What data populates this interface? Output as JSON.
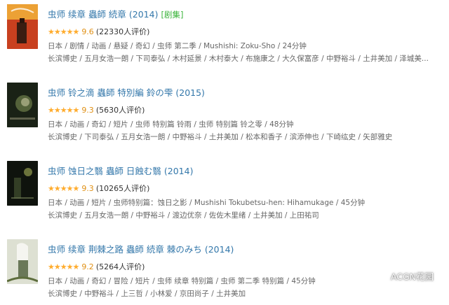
{
  "items": [
    {
      "title": "虫师 续章 蟲師 続章 (2014)",
      "play_label": "[剧集]",
      "stars": "★★★★★",
      "score": "9.6",
      "rating_count": "(22330人评价)",
      "meta_line1": "日本 / 剧情 / 动画 / 悬疑 / 奇幻 / 虫师 第二季 / Mushishi: Zoku-Sho / 24分钟",
      "meta_line2": "长滨博史 / 五月女浩一朗 / 下司泰弘 / 木村延景 / 木村泰大 / 布施康之 / 大久保富彦 / 中野裕斗 / 土井美加 / 泽城美..."
    },
    {
      "title": "虫师 铃之滴 蟲師 特別編 鈴の雫 (2015)",
      "play_label": "",
      "stars": "★★★★★",
      "score": "9.3",
      "rating_count": "(5630人评价)",
      "meta_line1": "日本 / 动画 / 奇幻 / 短片 / 虫师 特别篇 铃雨 / 虫师 特别篇 铃之零 / 48分钟",
      "meta_line2": "长滨博史 / 下司泰弘 / 五月女浩一朗 / 中野裕斗 / 土井美加 / 松本和香子 / 滨添伸也 / 下崎纮史 / 矢部雅史"
    },
    {
      "title": "虫师 蚀日之翳 蟲師 日蝕む翳 (2014)",
      "play_label": "",
      "stars": "★★★★★",
      "score": "9.3",
      "rating_count": "(10265人评价)",
      "meta_line1": "日本 / 动画 / 短片 / 虫师特别篇：蚀日之影 / Mushishi Tokubetsu-hen: Hihamukage / 45分钟",
      "meta_line2": "长滨博史 / 五月女浩一朗 / 中野裕斗 / 渡边优奈 / 佐佐木里绪 / 土井美加 / 上田祐司"
    },
    {
      "title": "虫师 续章 荆棘之路 蟲師 続章 棘のみち (2014)",
      "play_label": "",
      "stars": "★★★★★",
      "score": "9.2",
      "rating_count": "(5264人评价)",
      "meta_line1": "日本 / 动画 / 奇幻 / 冒险 / 短片 / 虫师 续章 特别篇 / 虫师 第二季 特别篇 / 45分钟",
      "meta_line2": "长滨博史 / 中野裕斗 / 上三哲 / 小林爱 / 京田尚子 / 土井美加"
    }
  ],
  "watermark": {
    "text": "ACGN花园"
  },
  "colors": {
    "title": "#3377aa",
    "play": "#3bb43b",
    "star": "#ffac2d",
    "meta": "#666666"
  }
}
